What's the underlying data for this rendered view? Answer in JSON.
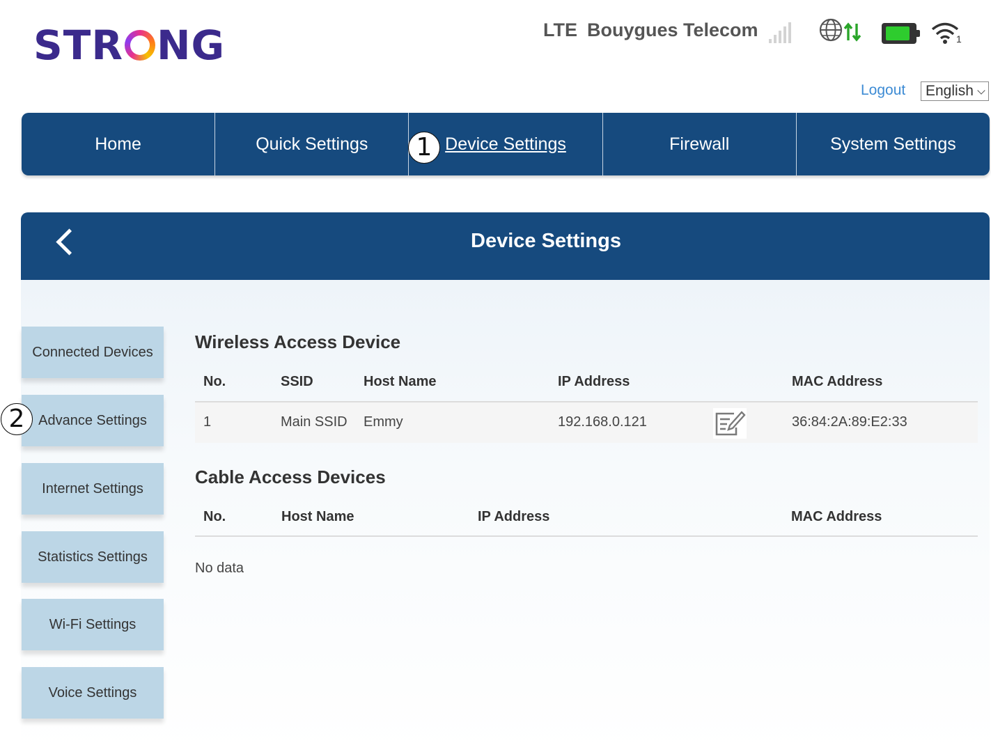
{
  "logo": {
    "before": "STR",
    "after": "NG"
  },
  "status": {
    "network_type": "LTE",
    "operator": "Bouygues Telecom",
    "wifi_clients": "1"
  },
  "header": {
    "logout": "Logout",
    "language": "English"
  },
  "nav": [
    {
      "label": "Home"
    },
    {
      "label": "Quick Settings"
    },
    {
      "label": "Device Settings"
    },
    {
      "label": "Firewall"
    },
    {
      "label": "System Settings"
    }
  ],
  "callouts": {
    "one": "1",
    "two": "2"
  },
  "panel": {
    "title": "Device Settings"
  },
  "sidebar": [
    {
      "label": "Connected Devices"
    },
    {
      "label": "Advance Settings"
    },
    {
      "label": "Internet Settings"
    },
    {
      "label": "Statistics Settings"
    },
    {
      "label": "Wi-Fi Settings"
    },
    {
      "label": "Voice Settings"
    }
  ],
  "wireless": {
    "title": "Wireless Access Device",
    "columns": {
      "no": "No.",
      "ssid": "SSID",
      "host": "Host Name",
      "ip": "IP Address",
      "mac": "MAC Address"
    },
    "rows": [
      {
        "no": "1",
        "ssid": "Main SSID",
        "host": "Emmy",
        "ip": "192.168.0.121",
        "mac": "36:84:2A:89:E2:33"
      }
    ]
  },
  "cable": {
    "title": "Cable Access Devices",
    "columns": {
      "no": "No.",
      "host": "Host Name",
      "ip": "IP Address",
      "mac": "MAC Address"
    },
    "empty": "No data"
  },
  "colors": {
    "nav": "#164a7e",
    "sidebar": "#bcd6e6",
    "link": "#3d8bd4",
    "battery": "#2ecc2e",
    "arrows": "#2aa52a"
  },
  "icons": [
    "signal-icon",
    "globe-data-icon",
    "battery-icon",
    "wifi-icon",
    "back-icon",
    "edit-icon",
    "chevron-down-icon"
  ]
}
